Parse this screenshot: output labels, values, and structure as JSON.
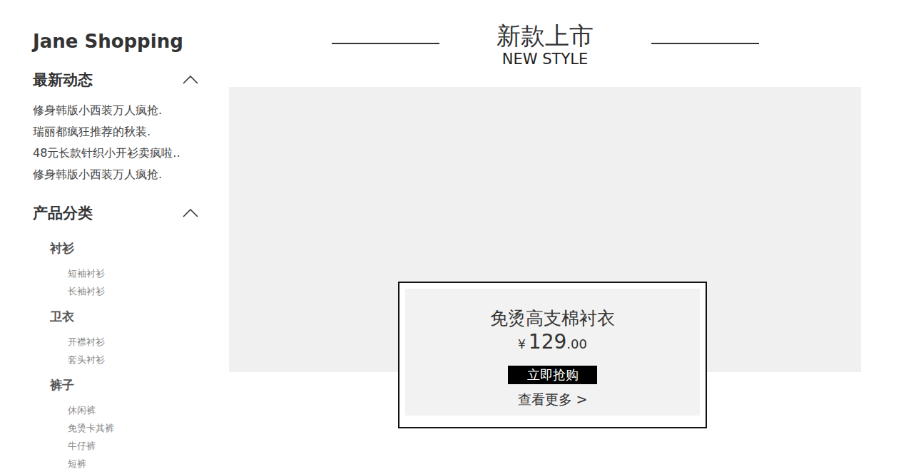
{
  "sidebar": {
    "brand": "Jane Shopping",
    "news": {
      "title": "最新动态",
      "expanded": true,
      "items": [
        "修身韩版小西装万人疯抢.",
        "瑞丽都疯狂推荐的秋装.",
        "48元长款针织小开衫卖疯啦..",
        "修身韩版小西装万人疯抢."
      ]
    },
    "categories": {
      "title": "产品分类",
      "expanded": true,
      "groups": [
        {
          "name": "衬衫",
          "items": [
            "短袖衬衫",
            "长袖衬衫"
          ]
        },
        {
          "name": "卫衣",
          "items": [
            "开襟衬衫",
            "套头衬衫"
          ]
        },
        {
          "name": "裤子",
          "items": [
            "休闲裤",
            "免烫卡其裤",
            "牛仔裤",
            "短裤"
          ]
        }
      ]
    }
  },
  "hero": {
    "title": "新款上市",
    "subtitle": "NEW STYLE"
  },
  "product": {
    "name": "免烫高支棉衬衣",
    "currency": "¥",
    "price_main": "129",
    "price_cents": ".00",
    "buy_label": "立即抢购",
    "more_label": "查看更多 >"
  }
}
